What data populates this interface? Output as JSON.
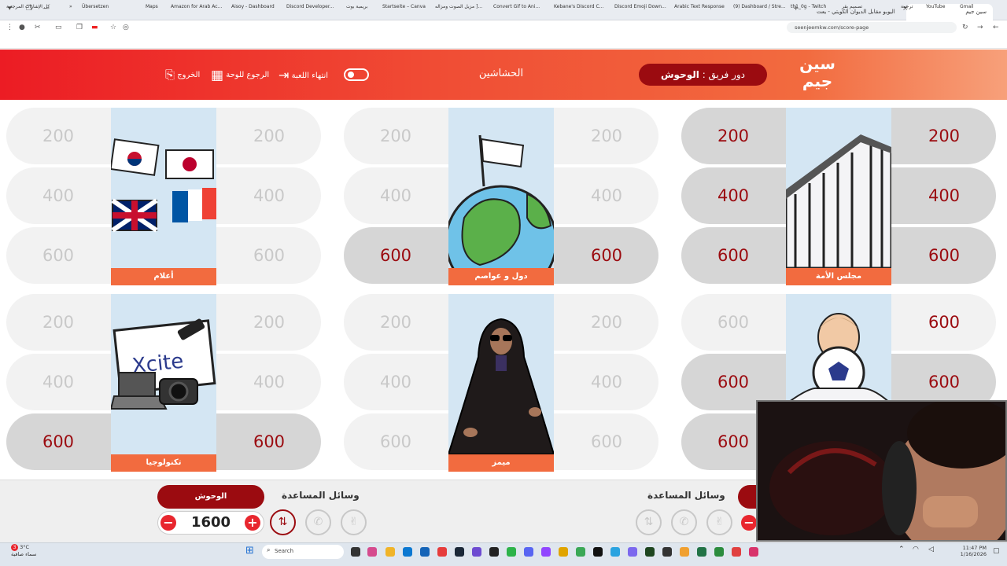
{
  "browser": {
    "tabs": [
      {
        "label": "اليوبو مقابل الديوان الكويتي - يعت"
      },
      {
        "label": "سين جيم",
        "active": true
      }
    ],
    "url": "seenjeemkw.com/score-page",
    "bookmarks": [
      "Übersetzen",
      "Maps",
      "Amazon for Arab Ac...",
      "Aisoy - Dashboard",
      "Discord Developer...",
      "بريمبة بوت",
      "Startseite – Canva",
      "مزيل الصوت ومزاله ]...",
      "Convert Gif to Ani...",
      "Kebane's Discord C...",
      "Discord Emoji Down...",
      "Arabic Text Response",
      "(9) Dashboard / Stre...",
      "th1_0g - Twitch",
      "تصميم بقر",
      "ترجمة",
      "YouTube",
      "Gmail",
      "كل الإشارات المرجعية"
    ]
  },
  "header": {
    "logo_line1": "سين",
    "logo_line2": "جيم",
    "turn_prefix": "دور فريق : ",
    "turn_team": "الوحوش",
    "game_title": "الحشاشين",
    "end_game": "انتهاء اللعبة",
    "back_to_board": "الرجوع للوحة",
    "exit": "الخروج"
  },
  "board": {
    "categories": [
      {
        "label": "مجلس الأمة",
        "left": [
          "600",
          "400",
          "200"
        ],
        "right": [
          "600",
          "400",
          "200"
        ],
        "active": [
          true,
          true,
          true
        ]
      },
      {
        "label": "دول و عواصم",
        "left": [
          "600",
          "400",
          "200"
        ],
        "right": [
          "600",
          "400",
          "200"
        ],
        "active": [
          true,
          false,
          false
        ]
      },
      {
        "label": "أعلام",
        "left": [
          "600",
          "400",
          "200"
        ],
        "right": [
          "600",
          "400",
          "200"
        ],
        "active": [
          false,
          false,
          false
        ]
      },
      {
        "label": "",
        "left": [
          "600",
          "600",
          "600"
        ],
        "right": [
          "600",
          "600",
          "600"
        ],
        "active_left": [
          true,
          true,
          false
        ],
        "active_right": [
          false,
          true,
          true
        ]
      },
      {
        "label": "ميمز",
        "left": [
          "600",
          "400",
          "200"
        ],
        "right": [
          "600",
          "400",
          "200"
        ],
        "active": [
          false,
          false,
          false
        ]
      },
      {
        "label": "تكنولوجيا",
        "left": [
          "600",
          "400",
          "200"
        ],
        "right": [
          "600",
          "400",
          "200"
        ],
        "active": [
          true,
          false,
          false
        ]
      }
    ],
    "xcite_text": "Xcite"
  },
  "bottom": {
    "team1_name": "الوحوش",
    "team1_score": "1600",
    "aids_title": "وسائل المساعدة",
    "minus": "−",
    "plus": "+"
  },
  "taskbar": {
    "search_placeholder": "Search",
    "weather_temp": "3°C",
    "weather_desc": "سماء صافية",
    "time": "11:47 PM",
    "date": "1/16/2026",
    "notif_count": "3"
  },
  "colors": {
    "header_red": "#ec1c24",
    "accent_dark_red": "#9b0b10",
    "card_label_orange": "#f26b3f"
  }
}
